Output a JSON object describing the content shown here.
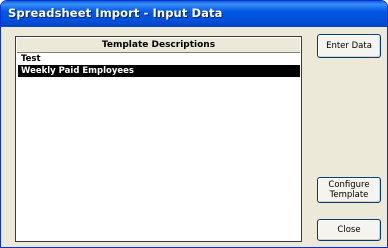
{
  "window": {
    "title": "Spreadsheet Import - Input Data"
  },
  "list": {
    "header": "Template Descriptions",
    "items": [
      {
        "label": "Test",
        "selected": false
      },
      {
        "label": "Weekly Paid Employees",
        "selected": true
      }
    ]
  },
  "buttons": {
    "enter_data": "Enter Data",
    "configure_line1": "Configure",
    "configure_line2": "Template",
    "close": "Close"
  }
}
